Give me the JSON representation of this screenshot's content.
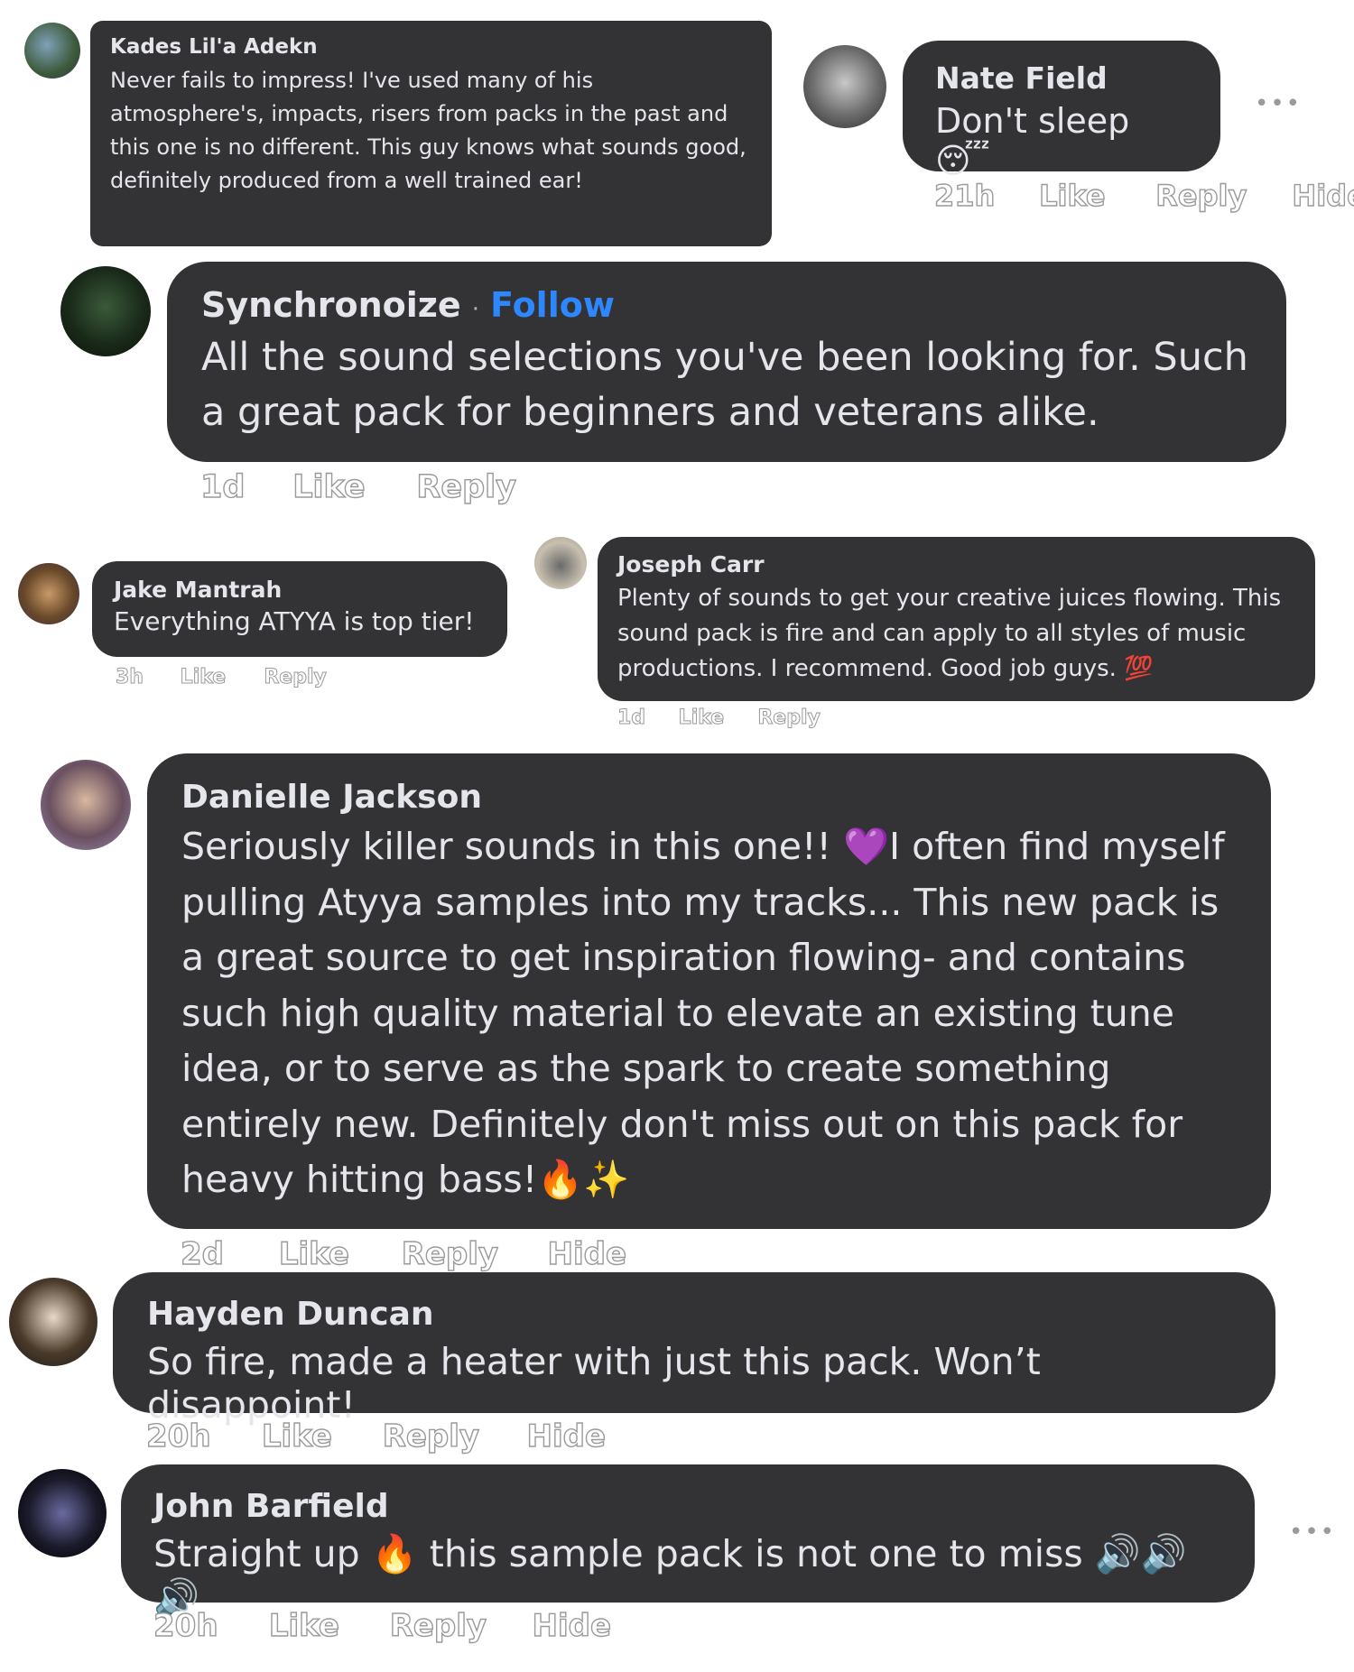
{
  "comments": [
    {
      "name": "Kades Lil'a Adekn",
      "text": "Never fails to impress! I've used many of his atmosphere's, impacts, risers from packs in the past and this one is no different. This guy knows what sounds good, definitely produced from a well trained ear!"
    },
    {
      "name": "Nate Field",
      "text": "Don't sleep",
      "emoji": "😴",
      "time": "21h",
      "like": "Like",
      "reply": "Reply",
      "hide": "Hide"
    },
    {
      "name": "Synchronoize",
      "separator": "·",
      "follow": "Follow",
      "text": "All the sound selections you've been looking for. Such a great pack for beginners and veterans alike.",
      "time": "1d",
      "like": "Like",
      "reply": "Reply"
    },
    {
      "name": "Jake Mantrah",
      "text": "Everything ATYYA is top tier!",
      "time": "3h",
      "like": "Like",
      "reply": "Reply"
    },
    {
      "name": "Joseph Carr",
      "text": "Plenty of sounds to get your creative juices flowing. This sound pack is fire and can apply to all styles of music productions. I recommend. Good job guys.",
      "emoji": "💯",
      "time": "1d",
      "like": "Like",
      "reply": "Reply"
    },
    {
      "name": "Danielle Jackson",
      "text1": "Seriously killer sounds in this one!!",
      "emoji1": "💜",
      "text2": "I often find myself pulling Atyya samples into my tracks... This new pack is a great source to get inspiration flowing- and contains such high quality material to elevate an existing tune idea, or to serve as the spark to create something entirely new. Definitely don't miss out on this pack for heavy hitting bass!",
      "emoji2": "🔥✨",
      "time": "2d",
      "like": "Like",
      "reply": "Reply",
      "hide": "Hide"
    },
    {
      "name": "Hayden Duncan",
      "text": "So fire, made a heater with just this pack. Won’t disappoint!",
      "time": "20h",
      "like": "Like",
      "reply": "Reply",
      "hide": "Hide"
    },
    {
      "name": "John Barfield",
      "text1": "Straight up",
      "emoji1": "🔥",
      "text2": "this sample pack is not one to miss",
      "emoji2": "🔊🔊🔊",
      "time": "20h",
      "like": "Like",
      "reply": "Reply",
      "hide": "Hide"
    }
  ],
  "more_icon": "•••",
  "colors": {
    "bubble": "#333336",
    "text": "#e4e6eb",
    "follow": "#2d88ff"
  },
  "icons": [
    "more-options-icon"
  ]
}
